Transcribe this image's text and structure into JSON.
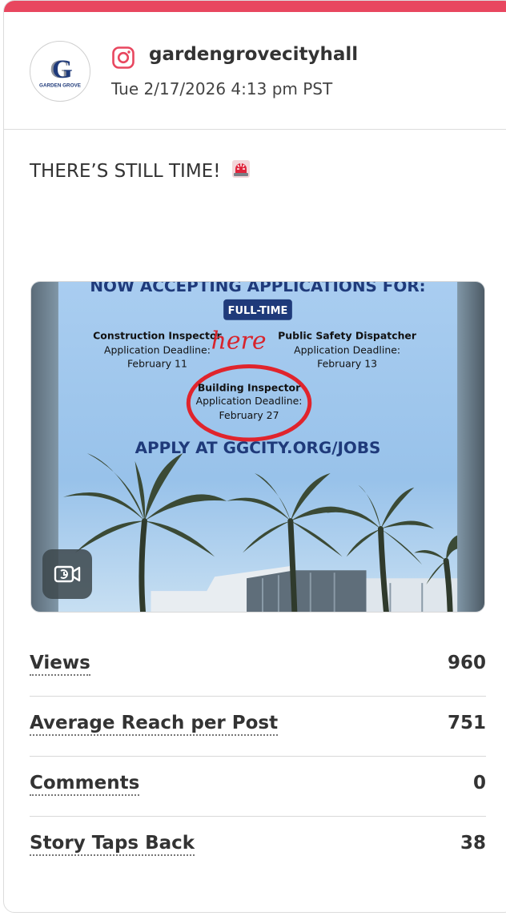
{
  "account": {
    "handle": "gardengrovecityhall",
    "timestamp": "Tue 2/17/2026 4:13 pm PST",
    "avatar_text": "GARDEN GROVE",
    "network_icon": "instagram-icon"
  },
  "post": {
    "caption": "THERE’S STILL TIME!",
    "caption_icon": "siren-icon",
    "media": {
      "type": "video",
      "headline": "NOW ACCEPTING APPLICATIONS FOR:",
      "badge": "FULL-TIME",
      "jobs": [
        {
          "title": "Construction Inspector",
          "deadline_label": "Application Deadline:",
          "deadline": "February 11"
        },
        {
          "title": "Public Safety Dispatcher",
          "deadline_label": "Application Deadline:",
          "deadline": "February 13"
        },
        {
          "title": "Building Inspector",
          "deadline_label": "Application Deadline:",
          "deadline": "February 27"
        }
      ],
      "annotation": "here",
      "cta": "APPLY AT GGCITY.ORG/JOBS",
      "badge_icon": "video-icon"
    }
  },
  "stats": [
    {
      "label": "Views",
      "value": "960"
    },
    {
      "label": "Average Reach per Post",
      "value": "751"
    },
    {
      "label": "Comments",
      "value": "0"
    },
    {
      "label": "Story Taps Back",
      "value": "38"
    }
  ],
  "colors": {
    "accent": "#e8475f",
    "badge_navy": "#1f3a7a",
    "circle_red": "#e0242c",
    "sky": "#9ec6ea"
  }
}
